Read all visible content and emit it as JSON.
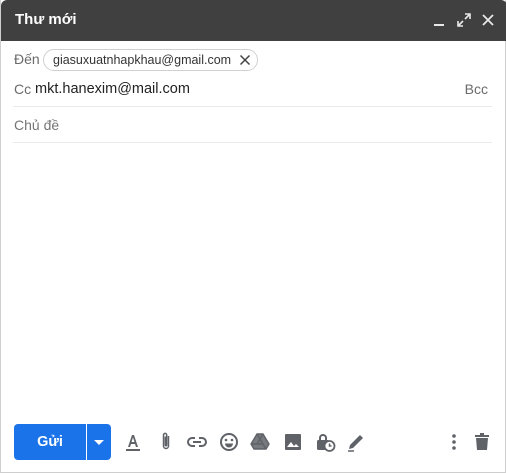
{
  "window": {
    "title": "Thư mới"
  },
  "titlebar_icons": [
    "minimize-icon",
    "expand-icon",
    "close-icon"
  ],
  "to": {
    "label": "Đến",
    "recipients": [
      "giasuxuatnhapkhau@gmail.com"
    ]
  },
  "cc": {
    "label": "Cc",
    "value": "mkt.hanexim@mail.com",
    "bcc_label": "Bcc"
  },
  "subject": {
    "placeholder": "Chủ đề"
  },
  "toolbar": {
    "send_label": "Gửi",
    "icons": [
      "formatting-options-icon",
      "attach-file-icon",
      "insert-link-icon",
      "insert-emoji-icon",
      "google-drive-icon",
      "insert-photo-icon",
      "confidential-mode-icon",
      "insert-signature-icon",
      "more-options-icon",
      "discard-draft-icon"
    ]
  },
  "colors": {
    "titlebar": "#404040",
    "accent": "#1a73e8",
    "icon": "#5f6368"
  }
}
